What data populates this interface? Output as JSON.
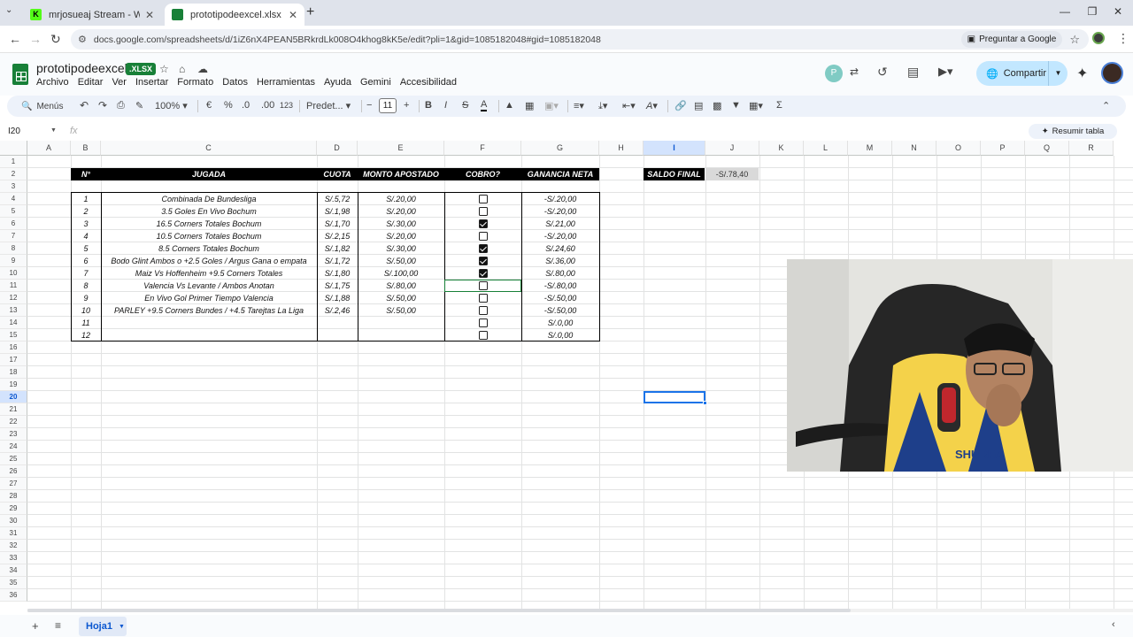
{
  "browser": {
    "tabs": [
      {
        "title": "mrjosueaj Stream - Watch Live o",
        "favicon_color": "#53fc18",
        "favicon_text": "K"
      },
      {
        "title": "prototipodeexcel.xlsx - Hojas de",
        "favicon_color": "#188038"
      }
    ],
    "url": "docs.google.com/spreadsheets/d/1iZ6nX4PEAN5BRkrdLk008O4khog8kK5e/edit?pli=1&gid=1085182048#gid=1085182048",
    "ask_google": "Preguntar a Google"
  },
  "doc": {
    "title": "prototipodeexcel",
    "badge": ".XLSX",
    "menu": [
      "Archivo",
      "Editar",
      "Ver",
      "Insertar",
      "Formato",
      "Datos",
      "Herramientas",
      "Ayuda",
      "Gemini",
      "Accesibilidad"
    ],
    "avatar_letter": "P",
    "share_label": "Compartir"
  },
  "toolbar": {
    "search": "Menús",
    "zoom": "100%",
    "currency": "€",
    "percent": "%",
    "dec_less": ".0",
    "dec_more": ".00",
    "number_fmt": "123",
    "font": "Predet...",
    "font_size": "11",
    "bold": "B",
    "italic": "I",
    "strike": "S",
    "text_color": "A",
    "sum": "Σ"
  },
  "formula_bar": {
    "name_box": "I20",
    "fx": "fx",
    "summarize": "Resumir tabla"
  },
  "grid": {
    "columns": [
      "A",
      "B",
      "C",
      "D",
      "E",
      "F",
      "G",
      "H",
      "I",
      "J",
      "K",
      "L",
      "M",
      "N",
      "O",
      "P",
      "Q",
      "R"
    ],
    "selected_column": "I",
    "rows": [
      "1",
      "2",
      "3",
      "4",
      "5",
      "6",
      "7",
      "8",
      "9",
      "10",
      "11",
      "12",
      "13",
      "14",
      "15",
      "16",
      "17",
      "18",
      "19",
      "20",
      "21",
      "22",
      "23",
      "24",
      "25",
      "26",
      "27",
      "28",
      "29",
      "30",
      "31",
      "32",
      "33",
      "34",
      "35",
      "36"
    ],
    "selected_row": "20"
  },
  "table": {
    "headers": [
      "N°",
      "JUGADA",
      "CUOTA",
      "MONTO APOSTADO",
      "COBRO?",
      "GANANCIA NETA"
    ],
    "rows": [
      {
        "n": "1",
        "jugada": "Combinada De Bundesliga",
        "cuota": "S/.5,72",
        "monto": "S/.20,00",
        "cobro": false,
        "ganancia": "-S/.20,00"
      },
      {
        "n": "2",
        "jugada": "3.5 Goles En Vivo Bochum",
        "cuota": "S/.1,98",
        "monto": "S/.20,00",
        "cobro": false,
        "ganancia": "-S/.20,00"
      },
      {
        "n": "3",
        "jugada": "16.5 Corners Totales Bochum",
        "cuota": "S/.1,70",
        "monto": "S/.30,00",
        "cobro": true,
        "ganancia": "S/.21,00"
      },
      {
        "n": "4",
        "jugada": "10.5 Corners Totales Bochum",
        "cuota": "S/.2,15",
        "monto": "S/.20,00",
        "cobro": false,
        "ganancia": "-S/.20,00"
      },
      {
        "n": "5",
        "jugada": "8.5 Corners Totales Bochum",
        "cuota": "S/.1,82",
        "monto": "S/.30,00",
        "cobro": true,
        "ganancia": "S/.24,60"
      },
      {
        "n": "6",
        "jugada": "Bodo Glint Ambos o +2.5 Goles / Argus Gana o empata",
        "cuota": "S/.1,72",
        "monto": "S/.50,00",
        "cobro": true,
        "ganancia": "S/.36,00"
      },
      {
        "n": "7",
        "jugada": "Maiz Vs Hoffenheim +9.5 Corners Totales",
        "cuota": "S/.1,80",
        "monto": "S/.100,00",
        "cobro": true,
        "ganancia": "S/.80,00"
      },
      {
        "n": "8",
        "jugada": "Valencia Vs Levante / Ambos Anotan",
        "cuota": "S/.1,75",
        "monto": "S/.80,00",
        "cobro": false,
        "ganancia": "-S/.80,00"
      },
      {
        "n": "9",
        "jugada": "En Vivo Gol Primer Tiempo Valencia",
        "cuota": "S/.1,88",
        "monto": "S/.50,00",
        "cobro": false,
        "ganancia": "-S/.50,00"
      },
      {
        "n": "10",
        "jugada": "PARLEY +9.5 Corners Bundes / +4.5 Tarejtas La Liga",
        "cuota": "S/.2,46",
        "monto": "S/.50,00",
        "cobro": false,
        "ganancia": "-S/.50,00"
      },
      {
        "n": "11",
        "jugada": "",
        "cuota": "",
        "monto": "",
        "cobro": false,
        "ganancia": "S/.0,00"
      },
      {
        "n": "12",
        "jugada": "",
        "cuota": "",
        "monto": "",
        "cobro": false,
        "ganancia": "S/.0,00"
      }
    ]
  },
  "saldo": {
    "label": "SALDO FINAL",
    "value": "-S/.78,40"
  },
  "sheets": {
    "active": "Hoja1"
  },
  "webcam_jersey_text": "SHURFA"
}
